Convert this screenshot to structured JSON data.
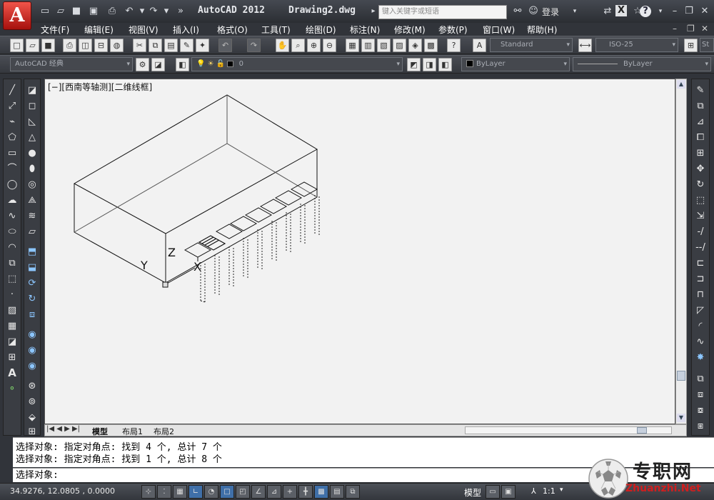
{
  "titlebar": {
    "app_logo": "A",
    "app_name": "AutoCAD 2012",
    "document": "Drawing2.dwg",
    "search_placeholder": "键入关键字或短语",
    "login_label": "登录",
    "help_label": "?"
  },
  "menubar": {
    "items": [
      "文件(F)",
      "编辑(E)",
      "视图(V)",
      "插入(I)",
      "格式(O)",
      "工具(T)",
      "绘图(D)",
      "标注(N)",
      "修改(M)",
      "参数(P)",
      "窗口(W)",
      "帮助(H)"
    ]
  },
  "toolbar2": {
    "text_style": "Standard",
    "dim_style": "ISO-25",
    "extra_style": "St"
  },
  "toolbar3": {
    "workspace": "AutoCAD 经典",
    "layer": "0",
    "color": "ByLayer",
    "linetype": "ByLayer"
  },
  "viewport": {
    "label": "[−][西南等轴测][二维线框]",
    "axis_y": "Y",
    "axis_z": "Z",
    "axis_x": "X"
  },
  "tabs": [
    "模型",
    "布局1",
    "布局2"
  ],
  "command": {
    "history": [
      "选择对象: 指定对角点: 找到 4 个, 总计 7 个",
      "选择对象: 指定对角点: 找到 1 个, 总计 8 个"
    ],
    "prompt": "选择对象:"
  },
  "status": {
    "coords": "34.9276,  12.0805 , 0.0000",
    "model_label": "模型",
    "scale": "1:1"
  },
  "watermark": {
    "cn": "专职网",
    "en": "Zhuanzhi.Net"
  },
  "colors": {
    "chrome": "#31343a",
    "canvas": "#f2f2f2",
    "accent_red": "#c5211a"
  }
}
